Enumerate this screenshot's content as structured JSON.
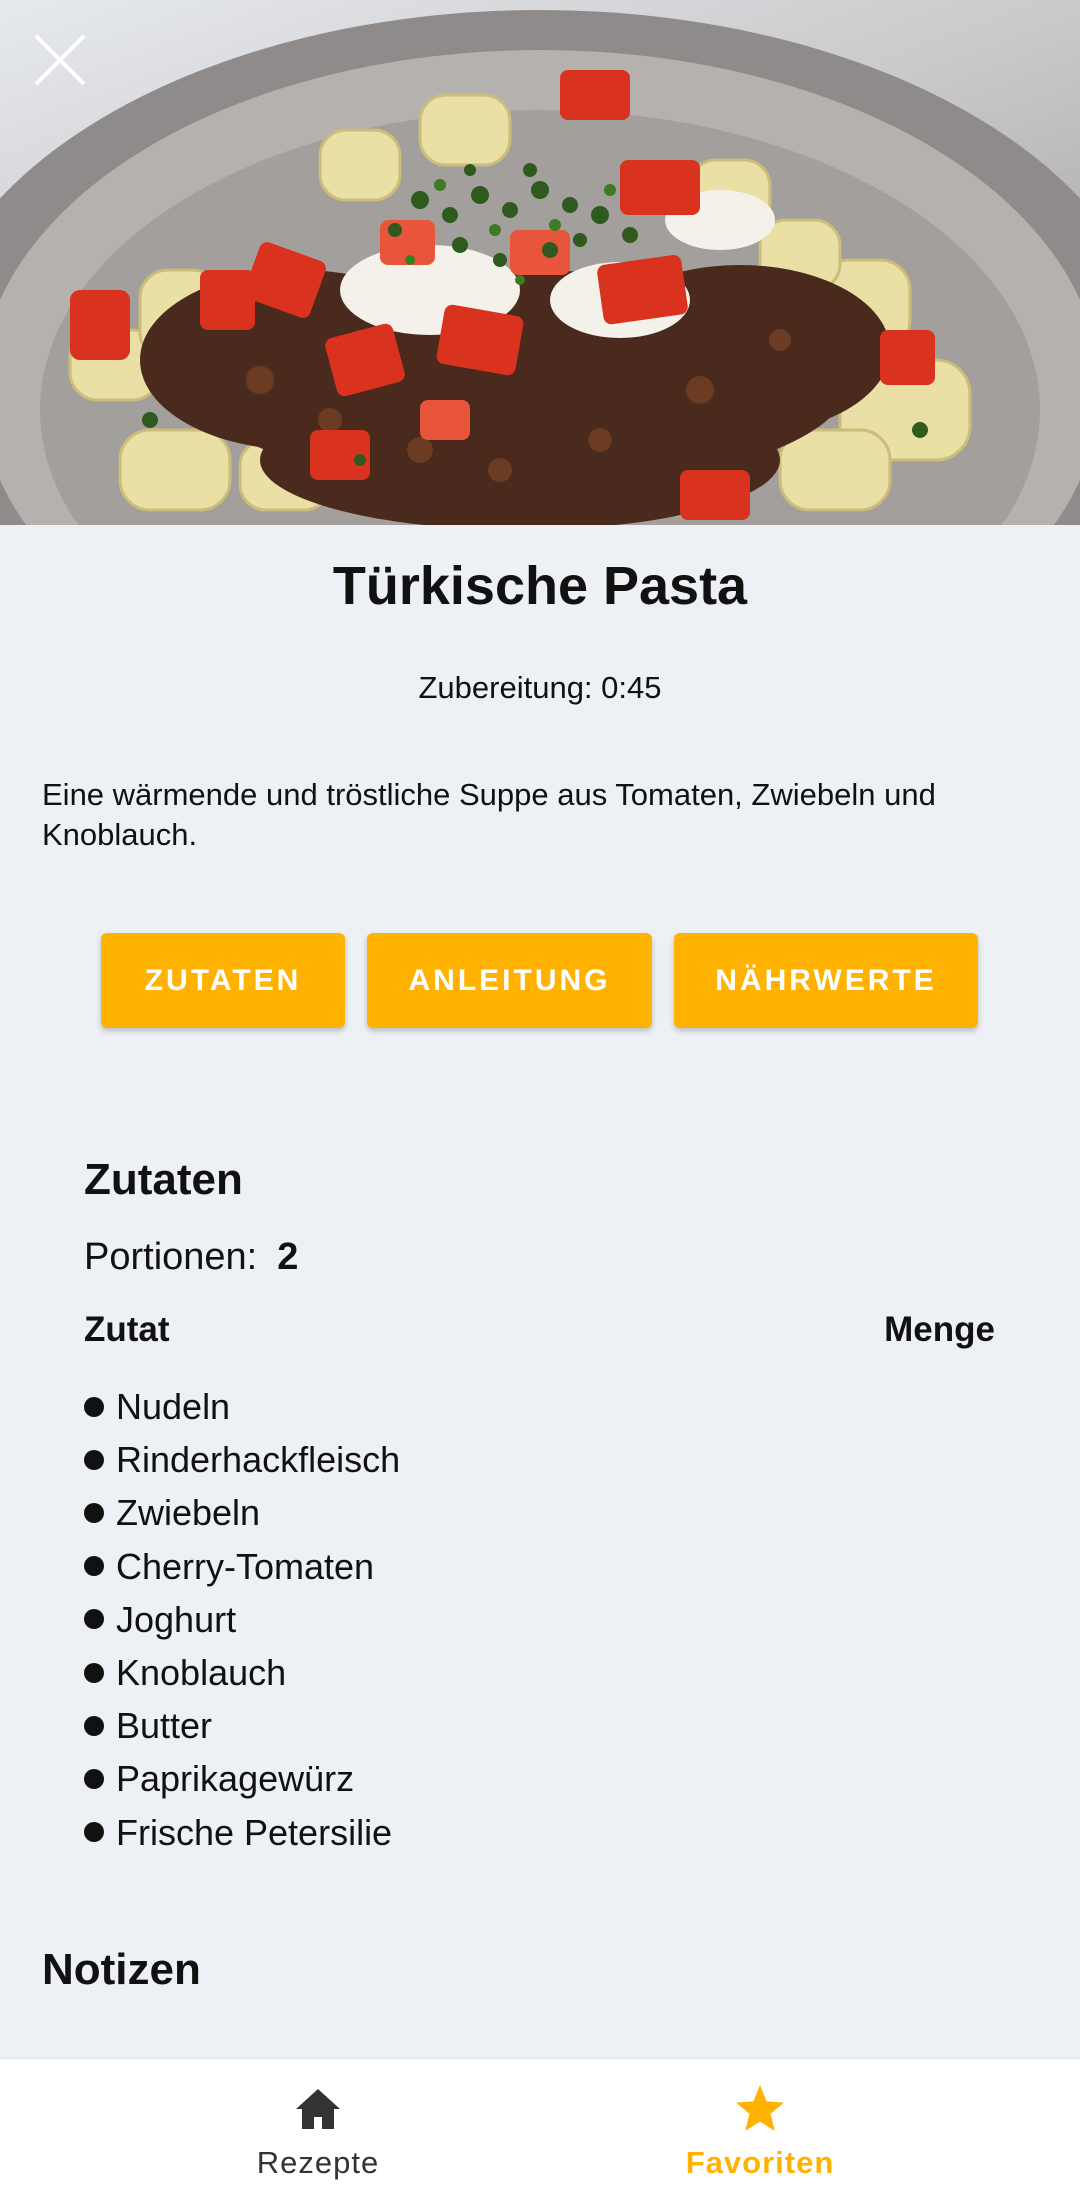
{
  "hero": {
    "image": "pasta-dish-photo"
  },
  "close": {
    "icon": "close-icon"
  },
  "recipe": {
    "title": "Türkische Pasta",
    "prep_time": "Zubereitung: 0:45",
    "description": "Eine wärmende und tröstliche Suppe aus Tomaten, Zwiebeln und Knoblauch."
  },
  "tabs": [
    {
      "label": "ZUTATEN"
    },
    {
      "label": "ANLEITUNG"
    },
    {
      "label": "NÄHRWERTE"
    }
  ],
  "ingredients_section": {
    "title": "Zutaten",
    "portions_label": "Portionen:",
    "portions_value": "2",
    "col_ingredient": "Zutat",
    "col_amount": "Menge",
    "items": [
      "Nudeln",
      "Rinderhackfleisch",
      "Zwiebeln",
      "Cherry-Tomaten",
      "Joghurt",
      "Knoblauch",
      "Butter",
      "Paprikagewürz",
      "Frische Petersilie"
    ]
  },
  "notes": {
    "title": "Notizen"
  },
  "bottom_nav": {
    "items": [
      {
        "label": "Rezepte",
        "icon": "home-icon",
        "active": false
      },
      {
        "label": "Favoriten",
        "icon": "star-icon",
        "active": true
      }
    ]
  },
  "colors": {
    "accent": "#ffb300",
    "background": "#edf0f5",
    "text": "#111111",
    "inactive_nav": "#333333"
  }
}
